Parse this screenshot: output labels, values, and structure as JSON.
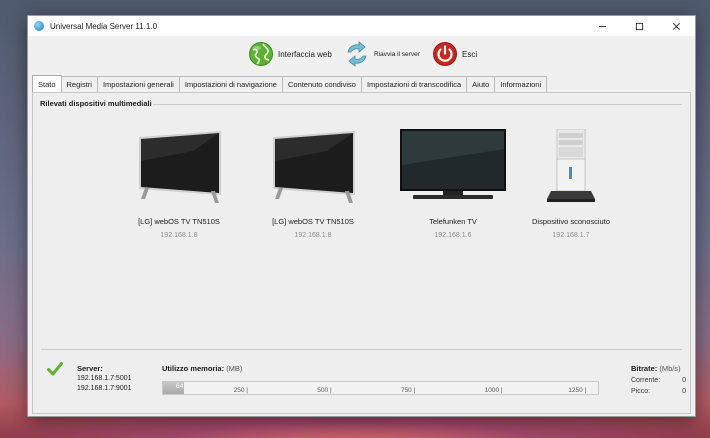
{
  "window": {
    "title": "Universal Media Server 11.1.0"
  },
  "toolbar": {
    "web_label": "Interfaccia web",
    "restart_label": "Riavvia il server",
    "quit_label": "Esci"
  },
  "tabs": [
    {
      "label": "Stato",
      "active": true
    },
    {
      "label": "Registri"
    },
    {
      "label": "Impostazioni generali"
    },
    {
      "label": "Impostazioni di navigazione"
    },
    {
      "label": "Contenuto condiviso"
    },
    {
      "label": "Impostazioni di transcodifica"
    },
    {
      "label": "Aiuto"
    },
    {
      "label": "Informazioni"
    }
  ],
  "section_title": "Rilevati dispositivi multimediali",
  "devices": [
    {
      "name": "[LG] webOS TV TN510S",
      "ip": "192.168.1.8",
      "icon": "tv-icon"
    },
    {
      "name": "[LG] webOS TV TN510S",
      "ip": "192.168.1.8",
      "icon": "tv-icon"
    },
    {
      "name": "Telefunken TV",
      "ip": "192.168.1.6",
      "icon": "tv-icon"
    },
    {
      "name": "Dispositivo sconosciuto",
      "ip": "192.168.1.7",
      "icon": "pc-tower-icon"
    }
  ],
  "server": {
    "label": "Server:",
    "addresses": [
      "192.168.1.7:5001",
      "192.168.1.7:9001"
    ]
  },
  "memory": {
    "label": "Utilizzo memoria:",
    "unit": "(MB)",
    "used": "64",
    "used_value": 64,
    "max_value": 1300,
    "ticks": [
      "250",
      "500",
      "750",
      "1000",
      "1250"
    ]
  },
  "bitrate": {
    "label": "Bitrate:",
    "unit": "(Mb/s)",
    "current_label": "Corrente:",
    "current_value": "0",
    "peak_label": "Picco:",
    "peak_value": "0"
  },
  "colors": {
    "accent_green": "#5fb135",
    "quit_red": "#c42a24",
    "restart_teal": "#4a9ab5"
  }
}
